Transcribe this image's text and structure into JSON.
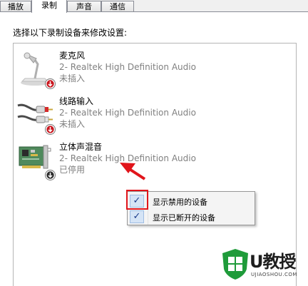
{
  "tabs": [
    {
      "label": "播放",
      "active": false
    },
    {
      "label": "录制",
      "active": true
    },
    {
      "label": "声音",
      "active": false
    },
    {
      "label": "通信",
      "active": false
    }
  ],
  "instruction": "选择以下录制设备来修改设置:",
  "devices": [
    {
      "name": "麦克风",
      "driver": "2- Realtek High Definition Audio",
      "state": "未插入",
      "icon": "microphone-icon"
    },
    {
      "name": "线路输入",
      "driver": "2- Realtek High Definition Audio",
      "state": "未插入",
      "icon": "line-in-cable-icon"
    },
    {
      "name": "立体声混音",
      "driver": "2- Realtek High Definition Audio",
      "state": "已停用",
      "icon": "sound-card-icon"
    }
  ],
  "context_menu": {
    "items": [
      {
        "label": "显示禁用的设备",
        "checked": true
      },
      {
        "label": "显示已断开的设备",
        "checked": true
      }
    ],
    "check_glyph": "✓"
  },
  "watermark": {
    "brand": "U教授",
    "url": "UJIAOSHOU.COM"
  },
  "colors": {
    "annotation_red": "#e1151b",
    "logo_green": "#1f9b3a",
    "status_down": "#2b2b2b"
  }
}
